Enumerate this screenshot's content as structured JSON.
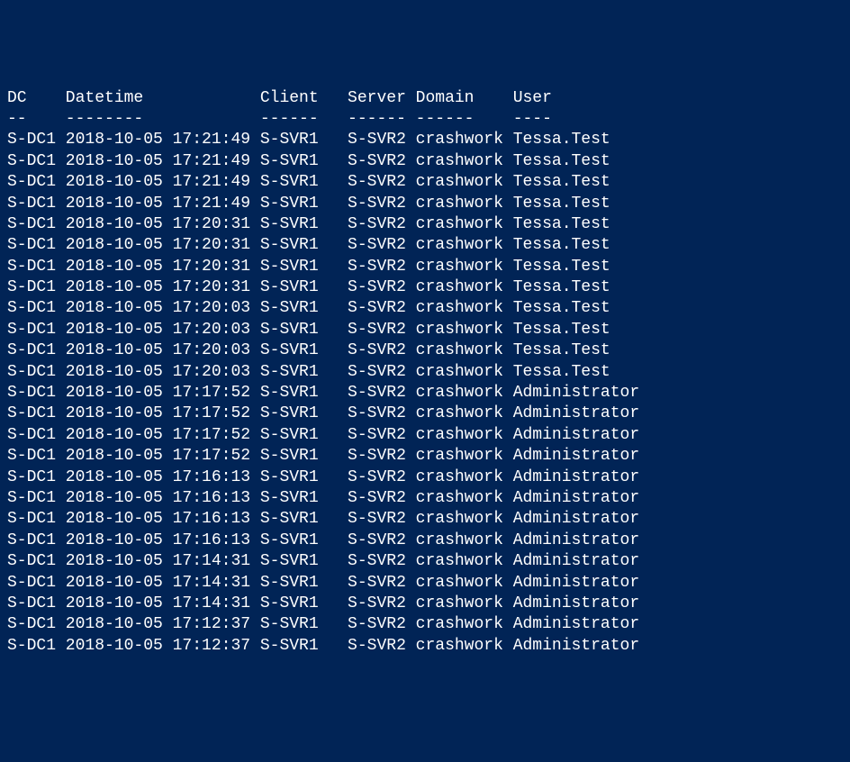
{
  "terminal": {
    "columns": {
      "dc": {
        "header": "DC",
        "underline": "--",
        "width": 6
      },
      "datetime": {
        "header": "Datetime",
        "underline": "--------",
        "width": 20
      },
      "client": {
        "header": "Client",
        "underline": "------",
        "width": 9
      },
      "server": {
        "header": "Server",
        "underline": "------",
        "width": 7
      },
      "domain": {
        "header": "Domain",
        "underline": "------",
        "width": 10
      },
      "user": {
        "header": "User",
        "underline": "----"
      }
    },
    "rows": [
      {
        "dc": "S-DC1",
        "datetime": "2018-10-05 17:21:49",
        "client": "S-SVR1",
        "server": "S-SVR2",
        "domain": "crashwork",
        "user": "Tessa.Test"
      },
      {
        "dc": "S-DC1",
        "datetime": "2018-10-05 17:21:49",
        "client": "S-SVR1",
        "server": "S-SVR2",
        "domain": "crashwork",
        "user": "Tessa.Test"
      },
      {
        "dc": "S-DC1",
        "datetime": "2018-10-05 17:21:49",
        "client": "S-SVR1",
        "server": "S-SVR2",
        "domain": "crashwork",
        "user": "Tessa.Test"
      },
      {
        "dc": "S-DC1",
        "datetime": "2018-10-05 17:21:49",
        "client": "S-SVR1",
        "server": "S-SVR2",
        "domain": "crashwork",
        "user": "Tessa.Test"
      },
      {
        "dc": "S-DC1",
        "datetime": "2018-10-05 17:20:31",
        "client": "S-SVR1",
        "server": "S-SVR2",
        "domain": "crashwork",
        "user": "Tessa.Test"
      },
      {
        "dc": "S-DC1",
        "datetime": "2018-10-05 17:20:31",
        "client": "S-SVR1",
        "server": "S-SVR2",
        "domain": "crashwork",
        "user": "Tessa.Test"
      },
      {
        "dc": "S-DC1",
        "datetime": "2018-10-05 17:20:31",
        "client": "S-SVR1",
        "server": "S-SVR2",
        "domain": "crashwork",
        "user": "Tessa.Test"
      },
      {
        "dc": "S-DC1",
        "datetime": "2018-10-05 17:20:31",
        "client": "S-SVR1",
        "server": "S-SVR2",
        "domain": "crashwork",
        "user": "Tessa.Test"
      },
      {
        "dc": "S-DC1",
        "datetime": "2018-10-05 17:20:03",
        "client": "S-SVR1",
        "server": "S-SVR2",
        "domain": "crashwork",
        "user": "Tessa.Test"
      },
      {
        "dc": "S-DC1",
        "datetime": "2018-10-05 17:20:03",
        "client": "S-SVR1",
        "server": "S-SVR2",
        "domain": "crashwork",
        "user": "Tessa.Test"
      },
      {
        "dc": "S-DC1",
        "datetime": "2018-10-05 17:20:03",
        "client": "S-SVR1",
        "server": "S-SVR2",
        "domain": "crashwork",
        "user": "Tessa.Test"
      },
      {
        "dc": "S-DC1",
        "datetime": "2018-10-05 17:20:03",
        "client": "S-SVR1",
        "server": "S-SVR2",
        "domain": "crashwork",
        "user": "Tessa.Test"
      },
      {
        "dc": "S-DC1",
        "datetime": "2018-10-05 17:17:52",
        "client": "S-SVR1",
        "server": "S-SVR2",
        "domain": "crashwork",
        "user": "Administrator"
      },
      {
        "dc": "S-DC1",
        "datetime": "2018-10-05 17:17:52",
        "client": "S-SVR1",
        "server": "S-SVR2",
        "domain": "crashwork",
        "user": "Administrator"
      },
      {
        "dc": "S-DC1",
        "datetime": "2018-10-05 17:17:52",
        "client": "S-SVR1",
        "server": "S-SVR2",
        "domain": "crashwork",
        "user": "Administrator"
      },
      {
        "dc": "S-DC1",
        "datetime": "2018-10-05 17:17:52",
        "client": "S-SVR1",
        "server": "S-SVR2",
        "domain": "crashwork",
        "user": "Administrator"
      },
      {
        "dc": "S-DC1",
        "datetime": "2018-10-05 17:16:13",
        "client": "S-SVR1",
        "server": "S-SVR2",
        "domain": "crashwork",
        "user": "Administrator"
      },
      {
        "dc": "S-DC1",
        "datetime": "2018-10-05 17:16:13",
        "client": "S-SVR1",
        "server": "S-SVR2",
        "domain": "crashwork",
        "user": "Administrator"
      },
      {
        "dc": "S-DC1",
        "datetime": "2018-10-05 17:16:13",
        "client": "S-SVR1",
        "server": "S-SVR2",
        "domain": "crashwork",
        "user": "Administrator"
      },
      {
        "dc": "S-DC1",
        "datetime": "2018-10-05 17:16:13",
        "client": "S-SVR1",
        "server": "S-SVR2",
        "domain": "crashwork",
        "user": "Administrator"
      },
      {
        "dc": "S-DC1",
        "datetime": "2018-10-05 17:14:31",
        "client": "S-SVR1",
        "server": "S-SVR2",
        "domain": "crashwork",
        "user": "Administrator"
      },
      {
        "dc": "S-DC1",
        "datetime": "2018-10-05 17:14:31",
        "client": "S-SVR1",
        "server": "S-SVR2",
        "domain": "crashwork",
        "user": "Administrator"
      },
      {
        "dc": "S-DC1",
        "datetime": "2018-10-05 17:14:31",
        "client": "S-SVR1",
        "server": "S-SVR2",
        "domain": "crashwork",
        "user": "Administrator"
      },
      {
        "dc": "S-DC1",
        "datetime": "2018-10-05 17:12:37",
        "client": "S-SVR1",
        "server": "S-SVR2",
        "domain": "crashwork",
        "user": "Administrator"
      },
      {
        "dc": "S-DC1",
        "datetime": "2018-10-05 17:12:37",
        "client": "S-SVR1",
        "server": "S-SVR2",
        "domain": "crashwork",
        "user": "Administrator"
      }
    ]
  }
}
